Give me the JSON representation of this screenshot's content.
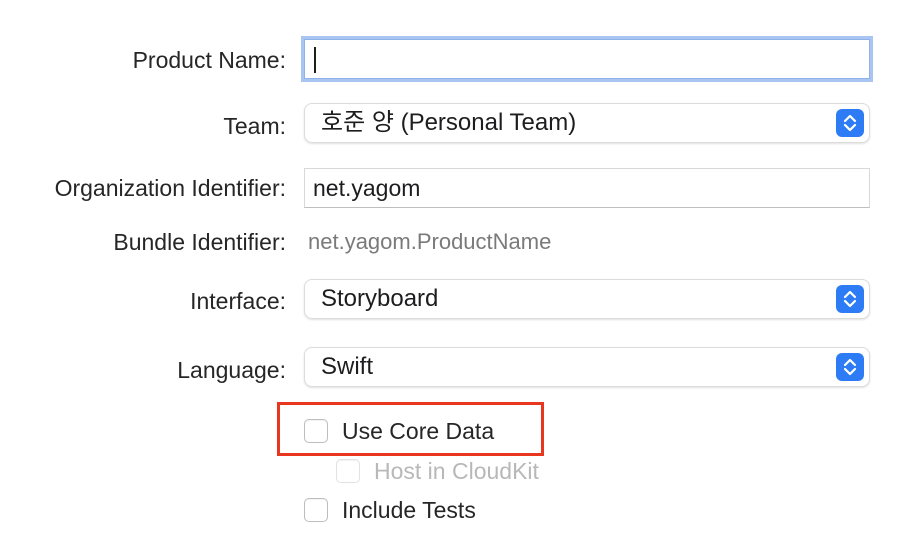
{
  "form": {
    "product_name": {
      "label": "Product Name:",
      "value": ""
    },
    "team": {
      "label": "Team:",
      "selected": "호준 양 (Personal Team)"
    },
    "organization_identifier": {
      "label": "Organization Identifier:",
      "value": "net.yagom"
    },
    "bundle_identifier": {
      "label": "Bundle Identifier:",
      "value": "net.yagom.ProductName"
    },
    "interface": {
      "label": "Interface:",
      "selected": "Storyboard"
    },
    "language": {
      "label": "Language:",
      "selected": "Swift"
    },
    "options": [
      {
        "label": "Use Core Data",
        "checked": false,
        "enabled": true,
        "highlighted": true
      },
      {
        "label": "Host in CloudKit",
        "checked": false,
        "enabled": false
      },
      {
        "label": "Include Tests",
        "checked": false,
        "enabled": true
      }
    ]
  },
  "colors": {
    "accent": "#2d7cf6",
    "focus_ring": "#a9c6f2",
    "highlight_annotation": "#e8361f"
  },
  "icons": {
    "popup_stepper": "chevron-up-down-icon"
  }
}
